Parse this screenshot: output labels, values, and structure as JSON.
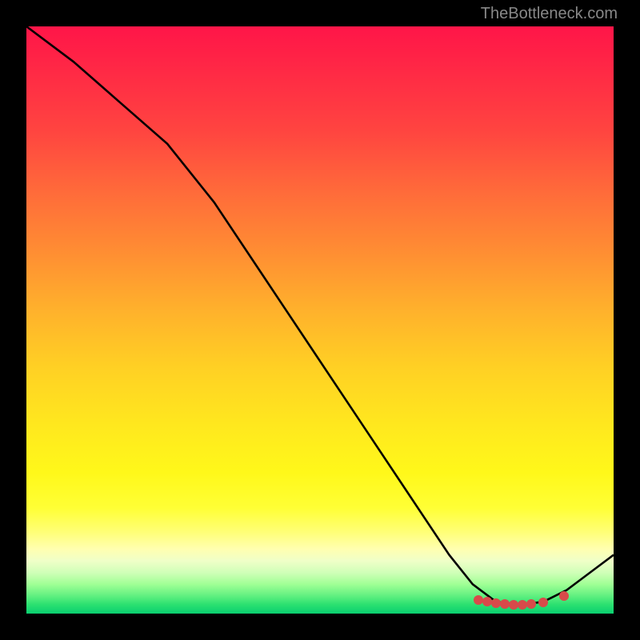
{
  "attribution": "TheBottleneck.com",
  "chart_data": {
    "type": "line",
    "title": "",
    "xlabel": "",
    "ylabel": "",
    "xlim": [
      0,
      100
    ],
    "ylim": [
      0,
      100
    ],
    "curve": [
      {
        "x": 0,
        "y": 100
      },
      {
        "x": 8,
        "y": 94
      },
      {
        "x": 16,
        "y": 87
      },
      {
        "x": 24,
        "y": 80
      },
      {
        "x": 32,
        "y": 70
      },
      {
        "x": 40,
        "y": 58
      },
      {
        "x": 48,
        "y": 46
      },
      {
        "x": 56,
        "y": 34
      },
      {
        "x": 64,
        "y": 22
      },
      {
        "x": 72,
        "y": 10
      },
      {
        "x": 76,
        "y": 5
      },
      {
        "x": 80,
        "y": 2
      },
      {
        "x": 84,
        "y": 1.5
      },
      {
        "x": 88,
        "y": 2
      },
      {
        "x": 92,
        "y": 4
      },
      {
        "x": 96,
        "y": 7
      },
      {
        "x": 100,
        "y": 10
      }
    ],
    "markers": [
      {
        "x": 77,
        "y": 2.3
      },
      {
        "x": 78.5,
        "y": 2.0
      },
      {
        "x": 80,
        "y": 1.8
      },
      {
        "x": 81.5,
        "y": 1.6
      },
      {
        "x": 83,
        "y": 1.5
      },
      {
        "x": 84.5,
        "y": 1.5
      },
      {
        "x": 86,
        "y": 1.6
      },
      {
        "x": 88,
        "y": 1.9
      },
      {
        "x": 91.5,
        "y": 3.0
      }
    ],
    "colors": {
      "curve": "#000000",
      "marker": "#d84a4a"
    }
  }
}
